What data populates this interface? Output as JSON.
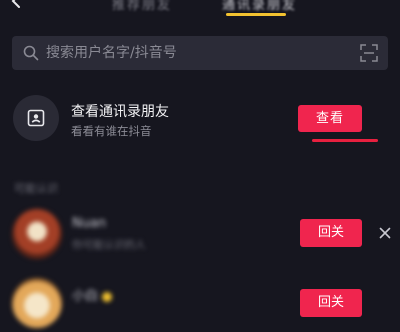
{
  "header": {
    "tabs": [
      {
        "label": "推荐朋友"
      },
      {
        "label": "通讯录朋友"
      }
    ],
    "active_tab": 1,
    "accent_color": "#f2c230"
  },
  "search": {
    "placeholder": "搜索用户名字/抖音号"
  },
  "contacts_card": {
    "title": "查看通讯录朋友",
    "subtitle": "看看有谁在抖音",
    "button_label": "查看"
  },
  "section": {
    "header": "可能认识"
  },
  "users": [
    {
      "name": "Nuan",
      "subtitle": "你可能认识的人",
      "button_label": "回关"
    },
    {
      "name": "小白",
      "subtitle": "",
      "button_label": "回关"
    }
  ],
  "colors": {
    "background": "#16161f",
    "primary_button": "#f0254e",
    "search_bg": "#2b2b37"
  }
}
